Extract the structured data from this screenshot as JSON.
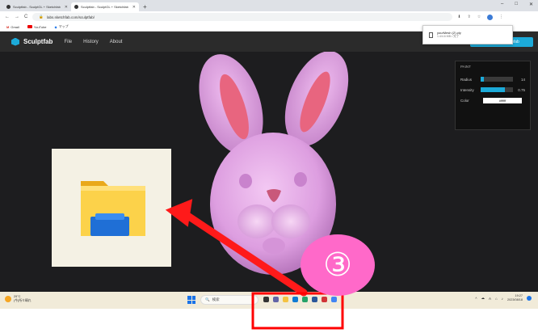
{
  "browser": {
    "tabs": [
      {
        "label": "Sculptfab - SculptGL + Sketchfab",
        "active": false
      },
      {
        "label": "Sculptfab - SculptGL + Sketchfab",
        "active": true
      }
    ],
    "new_tab": "+",
    "url": "labs.sketchfab.com/sculptfab/",
    "window_controls": [
      "–",
      "□",
      "✕"
    ],
    "bookmarks": [
      {
        "label": "Gmail",
        "icon": "gmail-icon"
      },
      {
        "label": "YouTube",
        "icon": "youtube-icon"
      },
      {
        "label": "マップ",
        "icon": "maps-icon"
      }
    ]
  },
  "download": {
    "filename": "yourMesh (2).ply",
    "status": "1.4/4.6 MB • 完了"
  },
  "app": {
    "brand": "Sculptfab",
    "menu": [
      "File",
      "History",
      "About"
    ],
    "sketchfab_button": "Export to Sketchfab",
    "top_right_text": "Sketchfab",
    "panel": {
      "title": "PAINT",
      "radius_label": "Radius",
      "radius_value": "14",
      "radius_fraction": 0.1,
      "intensity_label": "Intensity",
      "intensity_value": "0.75",
      "intensity_fraction": 0.75,
      "color_label": "Color",
      "color_value": "#ffffff"
    }
  },
  "taskbar": {
    "weather_temp": "29°C",
    "weather_desc": "(今)所々晴れ",
    "search_placeholder": "検索",
    "clock_time": "19:27",
    "clock_date": "2023/08/18",
    "tray_lang": "A"
  },
  "annotation": {
    "step_label": "③",
    "colors": {
      "arrow": "#ff1a1a",
      "circle": "#ff69c9",
      "box": "#ff0000"
    }
  },
  "colors": {
    "app_bg": "#1d1d1f",
    "accent": "#1caad9",
    "bunny": "#e5a5e6",
    "bunny_ear_inner": "#e8567e"
  }
}
